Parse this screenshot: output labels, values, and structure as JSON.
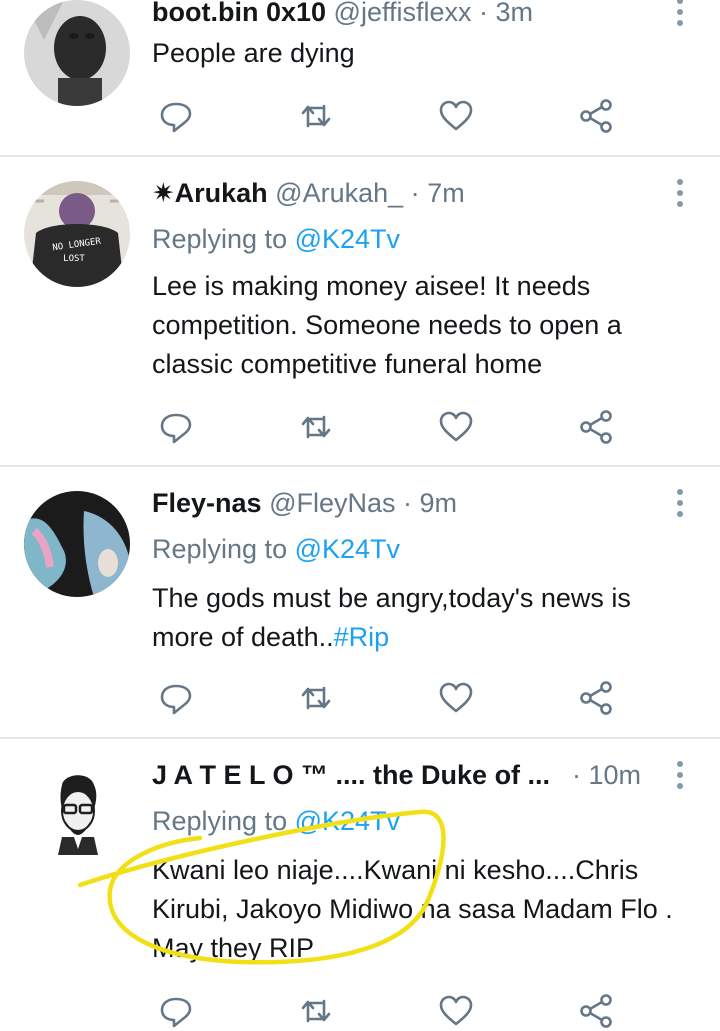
{
  "tweets": [
    {
      "name": "boot.bin 0x10",
      "handle": "@jeffisflexx",
      "time": "3m",
      "replying_label": "",
      "replying_to": "",
      "text": "People are dying",
      "hashtag": ""
    },
    {
      "name": "✷Arukah",
      "handle": "@Arukah_",
      "time": "7m",
      "replying_label": "Replying to",
      "replying_to": "@K24Tv",
      "text": "Lee is making money aisee! It needs competition. Someone needs to open a classic competitive funeral home",
      "hashtag": ""
    },
    {
      "name": "Fley-nas",
      "handle": "@FleyNas",
      "time": "9m",
      "replying_label": "Replying to",
      "replying_to": "@K24Tv",
      "text": "The gods must be angry,today's news is more of death..",
      "hashtag": "#Rip"
    },
    {
      "name": "J A T E L O ™ .... the Duke of ...",
      "handle": "",
      "time": "10m",
      "replying_label": "Replying to",
      "replying_to": "@K24Tv",
      "text": "Kwani leo niaje....Kwani ni kesho....Chris Kirubi, Jakoyo Midiwo na sasa Madam Flo . May they RIP",
      "hashtag": ""
    }
  ],
  "avatars": {
    "arukah_shirt_text_line1": "NO LONGER",
    "arukah_shirt_text_line2": "LOST"
  },
  "icons": [
    "reply-icon",
    "retweet-icon",
    "like-icon",
    "share-icon",
    "more-options-icon"
  ],
  "colors": {
    "link": "#1da1f2",
    "secondary_text": "#657786",
    "icon": "#657786",
    "divider": "#e1e8ed",
    "annotation": "#f2e016"
  }
}
